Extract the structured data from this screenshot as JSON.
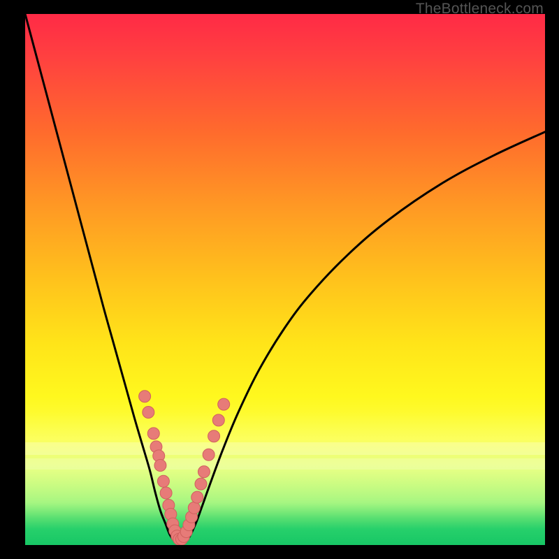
{
  "watermark": "TheBottleneck.com",
  "colors": {
    "curve": "#000000",
    "marker_fill": "#e77b78",
    "marker_stroke": "#cf615e"
  },
  "chart_data": {
    "type": "line",
    "title": "",
    "xlabel": "",
    "ylabel": "",
    "xlim": [
      0,
      100
    ],
    "ylim": [
      0,
      100
    ],
    "series": [
      {
        "name": "bottleneck-curve",
        "x": [
          0,
          3,
          6,
          9,
          12,
          15,
          17,
          19,
          21,
          22.5,
          24,
          25,
          26,
          27,
          27.8,
          28.6,
          29.4,
          30.5,
          31.5,
          32.2,
          33,
          34,
          35.5,
          38,
          41,
          45,
          50,
          55,
          62,
          70,
          80,
          90,
          100
        ],
        "y": [
          100,
          89,
          78,
          67,
          56,
          45,
          38,
          31,
          24,
          19,
          14,
          10,
          6.5,
          4,
          2,
          0.9,
          0.4,
          0.5,
          1.4,
          2.7,
          4.5,
          7.2,
          11.3,
          17.9,
          25,
          33,
          41,
          47.4,
          54.6,
          61.3,
          68,
          73.3,
          77.8
        ]
      }
    ],
    "markers": {
      "name": "highlight-points",
      "points": [
        {
          "x": 23.0,
          "y": 28.0
        },
        {
          "x": 23.7,
          "y": 25.0
        },
        {
          "x": 24.7,
          "y": 21.0
        },
        {
          "x": 25.2,
          "y": 18.5
        },
        {
          "x": 25.7,
          "y": 16.8
        },
        {
          "x": 26.0,
          "y": 15.0
        },
        {
          "x": 26.6,
          "y": 12.0
        },
        {
          "x": 27.1,
          "y": 9.8
        },
        {
          "x": 27.6,
          "y": 7.5
        },
        {
          "x": 28.0,
          "y": 5.8
        },
        {
          "x": 28.4,
          "y": 4.0
        },
        {
          "x": 28.8,
          "y": 2.7
        },
        {
          "x": 29.2,
          "y": 1.7
        },
        {
          "x": 29.6,
          "y": 1.1
        },
        {
          "x": 30.1,
          "y": 1.1
        },
        {
          "x": 30.5,
          "y": 1.6
        },
        {
          "x": 31.0,
          "y": 2.5
        },
        {
          "x": 31.5,
          "y": 3.8
        },
        {
          "x": 32.0,
          "y": 5.3
        },
        {
          "x": 32.5,
          "y": 7.0
        },
        {
          "x": 33.1,
          "y": 9.0
        },
        {
          "x": 33.8,
          "y": 11.5
        },
        {
          "x": 34.4,
          "y": 13.8
        },
        {
          "x": 35.3,
          "y": 17.0
        },
        {
          "x": 36.3,
          "y": 20.5
        },
        {
          "x": 37.2,
          "y": 23.5
        },
        {
          "x": 38.2,
          "y": 26.5
        }
      ]
    }
  }
}
